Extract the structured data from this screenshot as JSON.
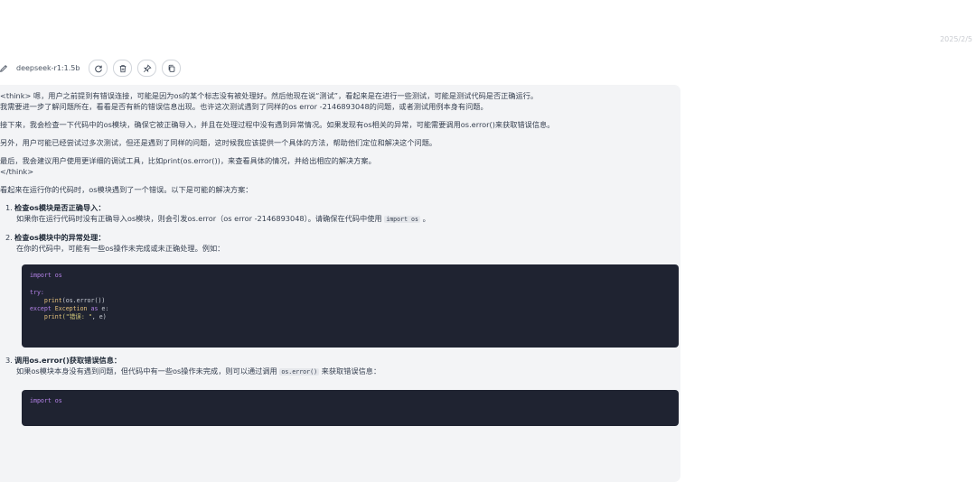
{
  "header": {
    "date": "2025/2/5"
  },
  "toolbar": {
    "model_name": "deepseek-r1:1.5b"
  },
  "message": {
    "think_1": "<think> 嗯，用户之前提到有错误连接，可能是因为os的某个标志没有被处理好。然后他现在说“测试”，看起来是在进行一些测试，可能是测试代码是否正确运行。",
    "think_2": "我需要进一步了解问题所在，看看是否有新的错误信息出现。也许这次测试遇到了同样的os error -2146893048的问题，或者测试用例本身有问题。",
    "think_3": "接下来，我会检查一下代码中的os模块，确保它被正确导入，并且在处理过程中没有遇到异常情况。如果发现有os相关的异常，可能需要调用os.error()来获取错误信息。",
    "think_4": "另外，用户可能已经尝试过多次测试，但还是遇到了同样的问题，这时候我应该提供一个具体的方法，帮助他们定位和解决这个问题。",
    "think_5": "最后，我会建议用户使用更详细的调试工具，比如print(os.error())，来查看具体的情况，并给出相应的解决方案。",
    "think_end": "</think>",
    "intro": "看起来在运行你的代码时，os模块遇到了一个错误。以下是可能的解决方案：",
    "items": [
      {
        "num": "1.",
        "title": "检查os模块是否正确导入：",
        "body_pre": "如果你在运行代码时没有正确导入os模块，则会引发os.error（os error -2146893048）。请确保在代码中使用",
        "code": "import os",
        "body_post": "。"
      },
      {
        "num": "2.",
        "title": "检查os模块中的异常处理：",
        "body": "在你的代码中，可能有一些os操作未完成或未正确处理。例如：",
        "codeblock": {
          "l1": "import os",
          "l2_kw": "try:",
          "l3_fn": "print",
          "l3_rest": "(os.error())",
          "l4_kw1": "except",
          "l4_mid": " Exception ",
          "l4_kw2": "as",
          "l4_end": " e:",
          "l5_fn": "print",
          "l5_str": "(\"错误: \"",
          "l5_end": ", e)"
        }
      },
      {
        "num": "3.",
        "title": "调用os.error()获取错误信息：",
        "body_pre": "如果os模块本身没有遇到问题，但代码中有一些os操作未完成，则可以通过调用",
        "code": "os.error()",
        "body_post": "来获取错误信息：",
        "codeblock": {
          "l1": "import os"
        }
      }
    ]
  },
  "icons": [
    "edit-icon",
    "regenerate-icon",
    "delete-icon",
    "pin-icon",
    "copy-icon"
  ]
}
